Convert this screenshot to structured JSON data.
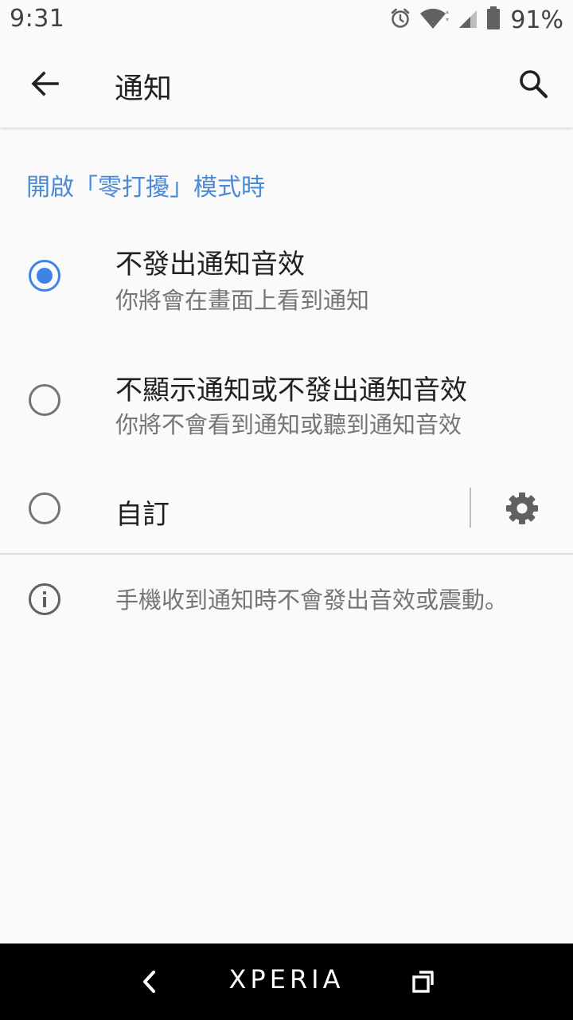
{
  "status_bar": {
    "time": "9:31",
    "battery": "91%",
    "icons": [
      "alarm-icon",
      "wifi-icon",
      "cell-signal-icon",
      "battery-icon"
    ]
  },
  "app_bar": {
    "title": "通知",
    "back_icon": "arrow-back-icon",
    "search_icon": "search-icon"
  },
  "section": {
    "header": "開啟「零打擾」模式時"
  },
  "options": [
    {
      "title": "不發出通知音效",
      "subtitle": "你將會在畫面上看到通知",
      "selected": true
    },
    {
      "title": "不顯示通知或不發出通知音效",
      "subtitle": "你將不會看到通知或聽到通知音效",
      "selected": false
    },
    {
      "title": "自訂",
      "subtitle": "",
      "selected": false,
      "settings_icon": "gear-icon"
    }
  ],
  "info": {
    "icon": "info-icon",
    "text": "手機收到通知時不會發出音效或震動。"
  },
  "nav_bar": {
    "brand": "XPERIA",
    "back_icon": "nav-back-icon",
    "recents_icon": "recents-icon"
  },
  "colors": {
    "accent": "#3e84e6",
    "header": "#4a8ad6",
    "background": "#fafafa",
    "nav_background": "#000000"
  }
}
